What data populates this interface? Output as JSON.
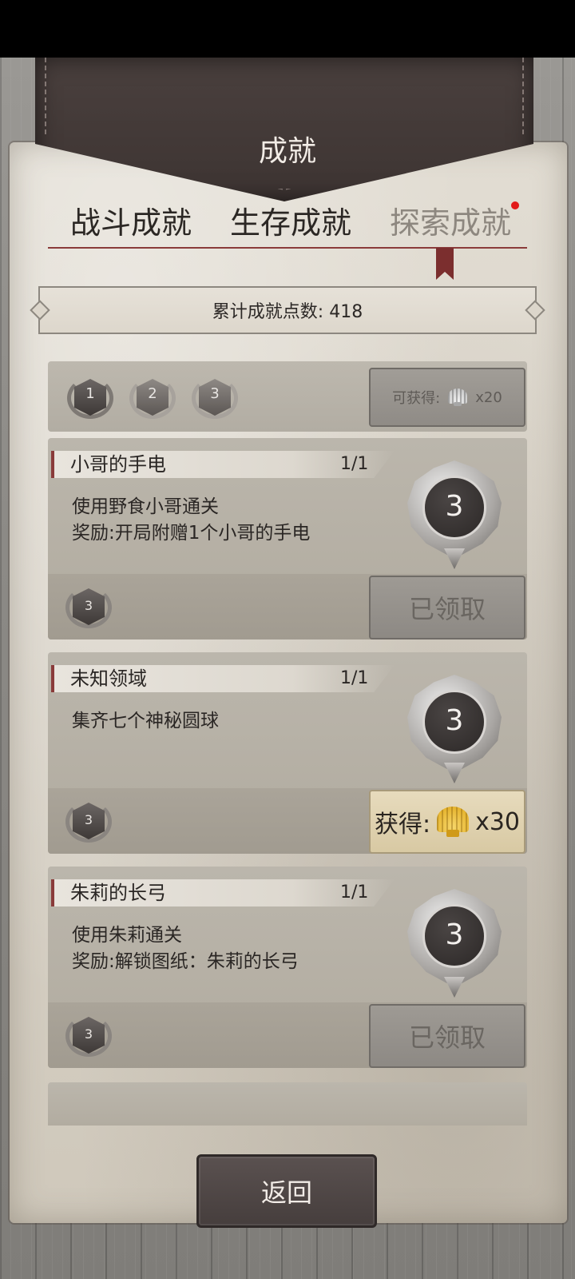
{
  "header": {
    "title": "成就"
  },
  "tabs": [
    {
      "label": "战斗成就",
      "active": false
    },
    {
      "label": "生存成就",
      "active": false
    },
    {
      "label": "探索成就",
      "active": true,
      "has_notification": true
    }
  ],
  "points": {
    "text": "累计成就点数: 418"
  },
  "levels": {
    "items": [
      "1",
      "2",
      "3"
    ],
    "claim_all": {
      "label": "可获得:",
      "icon": "shell-icon",
      "count": "x20"
    }
  },
  "cards": [
    {
      "title": "小哥的手电",
      "progress": "1/1",
      "description": "使用野食小哥通关\n奖励:开局附赠1个小哥的手电",
      "medal": "3",
      "badge": "3",
      "button": {
        "type": "claimed",
        "label": "已领取"
      }
    },
    {
      "title": "未知领域",
      "progress": "1/1",
      "description": "集齐七个神秘圆球",
      "medal": "3",
      "badge": "3",
      "button": {
        "type": "reward",
        "label": "获得:",
        "icon": "shell-icon",
        "count": "x30"
      }
    },
    {
      "title": "朱莉的长弓",
      "progress": "1/1",
      "description": "使用朱莉通关\n奖励:解锁图纸：朱莉的长弓",
      "medal": "3",
      "badge": "3",
      "button": {
        "type": "claimed",
        "label": "已领取"
      }
    }
  ],
  "footer": {
    "back_label": "返回"
  },
  "colors": {
    "accent": "#8a3b3a",
    "notification": "#e21a1a",
    "gold": "#e0a91c"
  }
}
